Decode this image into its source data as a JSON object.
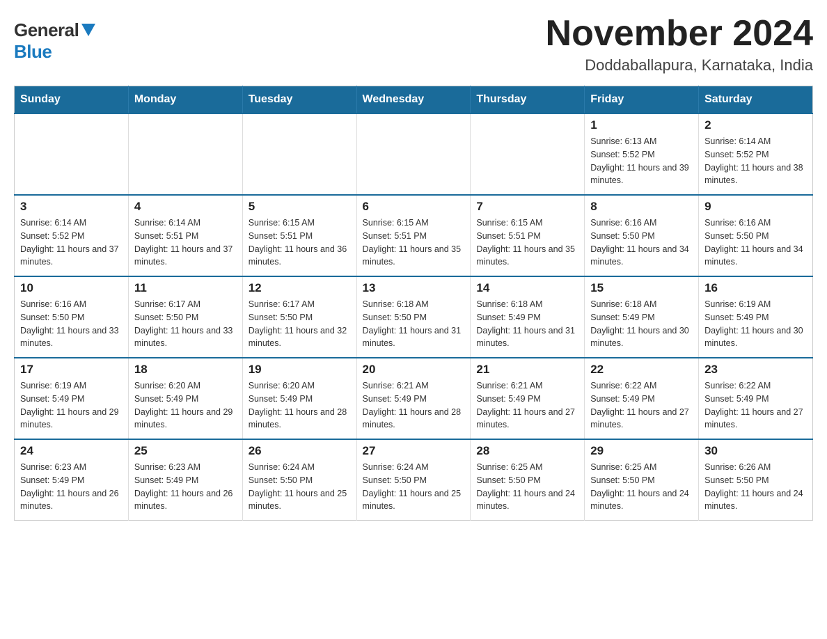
{
  "logo": {
    "general": "General",
    "blue": "Blue"
  },
  "title": "November 2024",
  "location": "Doddaballapura, Karnataka, India",
  "weekdays": [
    "Sunday",
    "Monday",
    "Tuesday",
    "Wednesday",
    "Thursday",
    "Friday",
    "Saturday"
  ],
  "weeks": [
    [
      {
        "day": "",
        "info": ""
      },
      {
        "day": "",
        "info": ""
      },
      {
        "day": "",
        "info": ""
      },
      {
        "day": "",
        "info": ""
      },
      {
        "day": "",
        "info": ""
      },
      {
        "day": "1",
        "info": "Sunrise: 6:13 AM\nSunset: 5:52 PM\nDaylight: 11 hours and 39 minutes."
      },
      {
        "day": "2",
        "info": "Sunrise: 6:14 AM\nSunset: 5:52 PM\nDaylight: 11 hours and 38 minutes."
      }
    ],
    [
      {
        "day": "3",
        "info": "Sunrise: 6:14 AM\nSunset: 5:52 PM\nDaylight: 11 hours and 37 minutes."
      },
      {
        "day": "4",
        "info": "Sunrise: 6:14 AM\nSunset: 5:51 PM\nDaylight: 11 hours and 37 minutes."
      },
      {
        "day": "5",
        "info": "Sunrise: 6:15 AM\nSunset: 5:51 PM\nDaylight: 11 hours and 36 minutes."
      },
      {
        "day": "6",
        "info": "Sunrise: 6:15 AM\nSunset: 5:51 PM\nDaylight: 11 hours and 35 minutes."
      },
      {
        "day": "7",
        "info": "Sunrise: 6:15 AM\nSunset: 5:51 PM\nDaylight: 11 hours and 35 minutes."
      },
      {
        "day": "8",
        "info": "Sunrise: 6:16 AM\nSunset: 5:50 PM\nDaylight: 11 hours and 34 minutes."
      },
      {
        "day": "9",
        "info": "Sunrise: 6:16 AM\nSunset: 5:50 PM\nDaylight: 11 hours and 34 minutes."
      }
    ],
    [
      {
        "day": "10",
        "info": "Sunrise: 6:16 AM\nSunset: 5:50 PM\nDaylight: 11 hours and 33 minutes."
      },
      {
        "day": "11",
        "info": "Sunrise: 6:17 AM\nSunset: 5:50 PM\nDaylight: 11 hours and 33 minutes."
      },
      {
        "day": "12",
        "info": "Sunrise: 6:17 AM\nSunset: 5:50 PM\nDaylight: 11 hours and 32 minutes."
      },
      {
        "day": "13",
        "info": "Sunrise: 6:18 AM\nSunset: 5:50 PM\nDaylight: 11 hours and 31 minutes."
      },
      {
        "day": "14",
        "info": "Sunrise: 6:18 AM\nSunset: 5:49 PM\nDaylight: 11 hours and 31 minutes."
      },
      {
        "day": "15",
        "info": "Sunrise: 6:18 AM\nSunset: 5:49 PM\nDaylight: 11 hours and 30 minutes."
      },
      {
        "day": "16",
        "info": "Sunrise: 6:19 AM\nSunset: 5:49 PM\nDaylight: 11 hours and 30 minutes."
      }
    ],
    [
      {
        "day": "17",
        "info": "Sunrise: 6:19 AM\nSunset: 5:49 PM\nDaylight: 11 hours and 29 minutes."
      },
      {
        "day": "18",
        "info": "Sunrise: 6:20 AM\nSunset: 5:49 PM\nDaylight: 11 hours and 29 minutes."
      },
      {
        "day": "19",
        "info": "Sunrise: 6:20 AM\nSunset: 5:49 PM\nDaylight: 11 hours and 28 minutes."
      },
      {
        "day": "20",
        "info": "Sunrise: 6:21 AM\nSunset: 5:49 PM\nDaylight: 11 hours and 28 minutes."
      },
      {
        "day": "21",
        "info": "Sunrise: 6:21 AM\nSunset: 5:49 PM\nDaylight: 11 hours and 27 minutes."
      },
      {
        "day": "22",
        "info": "Sunrise: 6:22 AM\nSunset: 5:49 PM\nDaylight: 11 hours and 27 minutes."
      },
      {
        "day": "23",
        "info": "Sunrise: 6:22 AM\nSunset: 5:49 PM\nDaylight: 11 hours and 27 minutes."
      }
    ],
    [
      {
        "day": "24",
        "info": "Sunrise: 6:23 AM\nSunset: 5:49 PM\nDaylight: 11 hours and 26 minutes."
      },
      {
        "day": "25",
        "info": "Sunrise: 6:23 AM\nSunset: 5:49 PM\nDaylight: 11 hours and 26 minutes."
      },
      {
        "day": "26",
        "info": "Sunrise: 6:24 AM\nSunset: 5:50 PM\nDaylight: 11 hours and 25 minutes."
      },
      {
        "day": "27",
        "info": "Sunrise: 6:24 AM\nSunset: 5:50 PM\nDaylight: 11 hours and 25 minutes."
      },
      {
        "day": "28",
        "info": "Sunrise: 6:25 AM\nSunset: 5:50 PM\nDaylight: 11 hours and 24 minutes."
      },
      {
        "day": "29",
        "info": "Sunrise: 6:25 AM\nSunset: 5:50 PM\nDaylight: 11 hours and 24 minutes."
      },
      {
        "day": "30",
        "info": "Sunrise: 6:26 AM\nSunset: 5:50 PM\nDaylight: 11 hours and 24 minutes."
      }
    ]
  ]
}
